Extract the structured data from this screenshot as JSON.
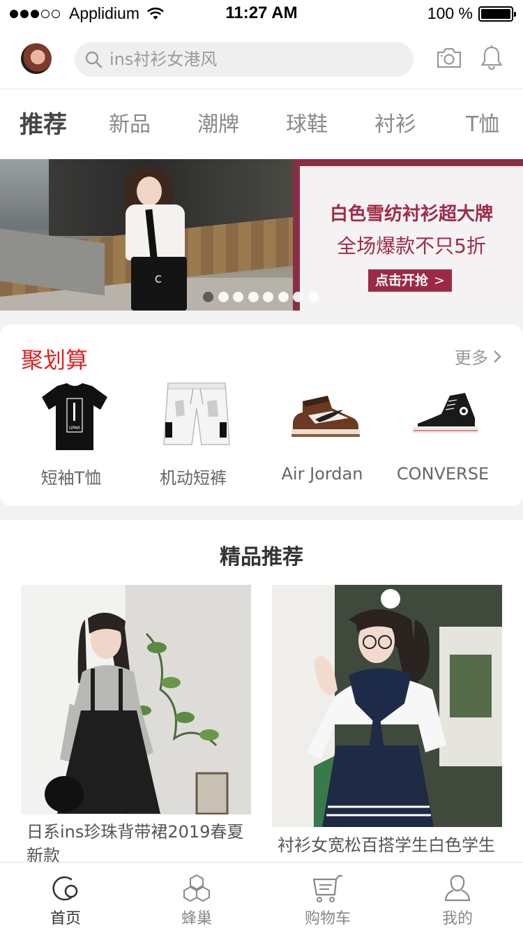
{
  "status_bar": {
    "carrier": "Applidium",
    "time": "11:27 AM",
    "battery": "100 %",
    "signal_dots_filled": 3,
    "signal_dots_total": 5
  },
  "header": {
    "search_placeholder": "ins衬衫女港风",
    "icons": [
      "avatar",
      "search-icon",
      "camera-icon",
      "bell-icon"
    ]
  },
  "tabs": [
    {
      "label": "推荐",
      "active": true
    },
    {
      "label": "新品",
      "active": false
    },
    {
      "label": "潮牌",
      "active": false
    },
    {
      "label": "球鞋",
      "active": false
    },
    {
      "label": "衬衫",
      "active": false
    },
    {
      "label": "T恤",
      "active": false
    }
  ],
  "banner": {
    "title": "白色雪纺衬衫超大牌",
    "subtitle": "全场爆款不只5折",
    "button": "点击开抢",
    "dots_total": 8,
    "active_dot": 0
  },
  "deals": {
    "title": "聚划算",
    "more": "更多",
    "items": [
      {
        "label": "短袖T恤"
      },
      {
        "label": "机动短裤"
      },
      {
        "label": "Air Jordan"
      },
      {
        "label": "CONVERSE"
      }
    ]
  },
  "recommend": {
    "title": "精品推荐",
    "products": [
      {
        "title": "日系ins珍珠背带裙2019春夏新款"
      },
      {
        "title": "衬衫女宽松百搭学生白色学生"
      }
    ]
  },
  "tabbar": [
    {
      "label": "首页",
      "icon": "home-icon",
      "active": true
    },
    {
      "label": "蜂巢",
      "icon": "hive-icon",
      "active": false
    },
    {
      "label": "购物车",
      "icon": "cart-icon",
      "active": false
    },
    {
      "label": "我的",
      "icon": "profile-icon",
      "active": false
    }
  ],
  "colors": {
    "accent_red": "#e02020",
    "banner_maroon": "#9c2a44",
    "background_gray": "#f2f2f2"
  }
}
